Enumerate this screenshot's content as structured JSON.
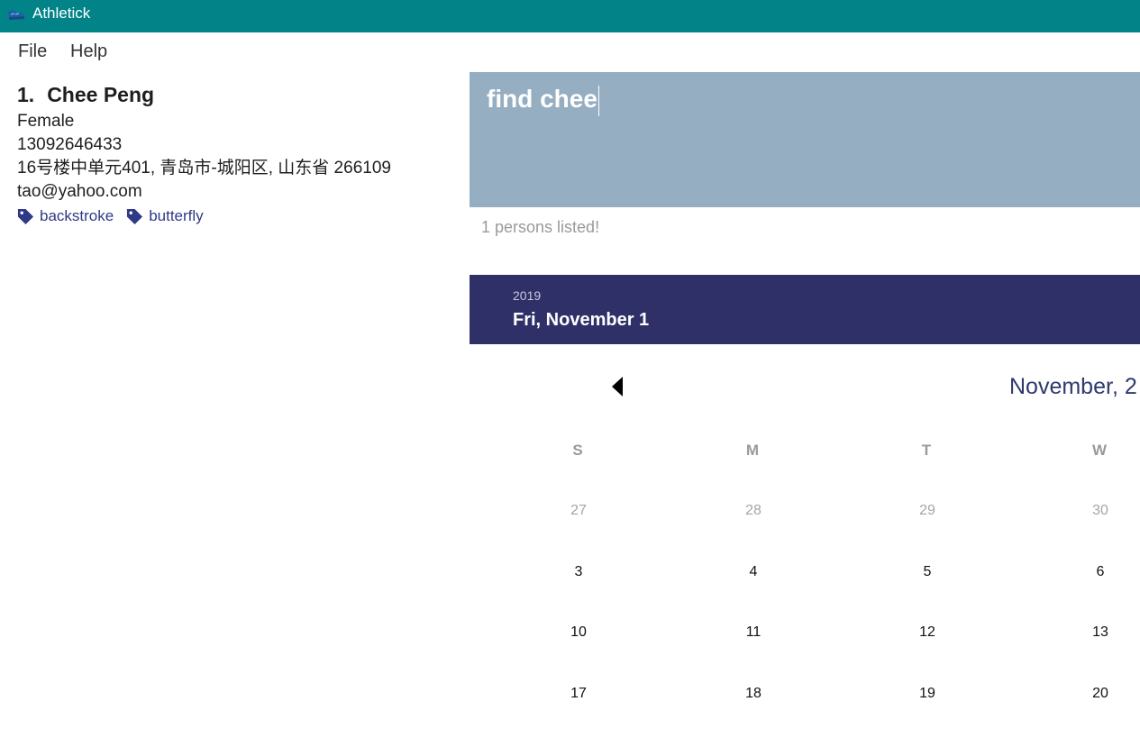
{
  "window": {
    "title": "Athletick",
    "accent_color": "#028388"
  },
  "menu": {
    "items": [
      "File",
      "Help"
    ]
  },
  "person": {
    "index": "1.",
    "name": "Chee Peng",
    "gender": "Female",
    "phone": "13092646433",
    "address": "16号楼中单元401, 青岛市-城阳区, 山东省 266109",
    "email": "tao@yahoo.com",
    "tags": [
      "backstroke",
      "butterfly"
    ],
    "tag_color": "#2e3a86"
  },
  "command": {
    "text": "find chee",
    "bg_color": "#96aec1"
  },
  "result": {
    "text": "1 persons listed!"
  },
  "date_header": {
    "year": "2019",
    "date": "Fri, November 1",
    "bg_color": "#303069"
  },
  "calendar": {
    "month_title": "November, 2",
    "day_headers": [
      "S",
      "M",
      "T",
      "W"
    ],
    "weeks": [
      [
        "27",
        "28",
        "29",
        "30"
      ],
      [
        "3",
        "4",
        "5",
        "6"
      ],
      [
        "10",
        "11",
        "12",
        "13"
      ],
      [
        "17",
        "18",
        "19",
        "20"
      ]
    ],
    "muted_weeks": [
      0
    ]
  }
}
